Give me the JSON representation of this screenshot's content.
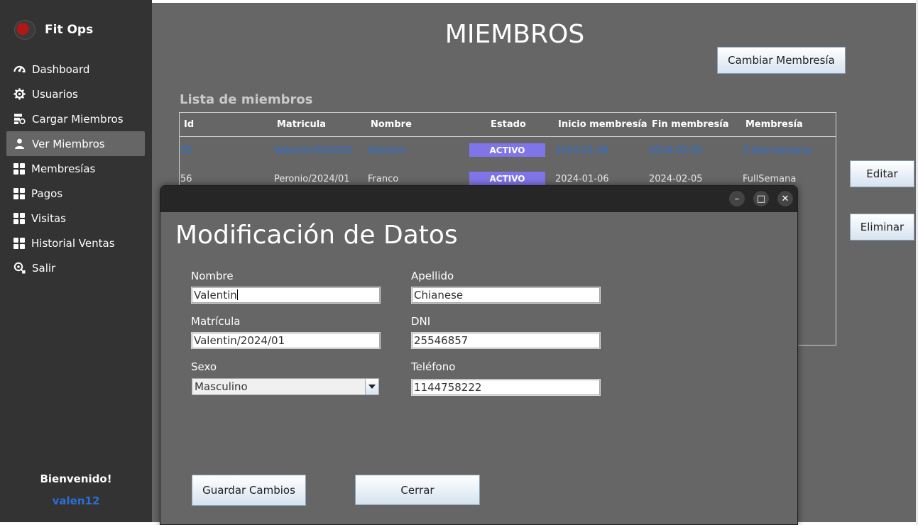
{
  "sidebar": {
    "app_name": "Fit Ops",
    "items": [
      {
        "label": "Dashboard",
        "icon": "speedometer-icon"
      },
      {
        "label": "Usuarios",
        "icon": "gear-icon"
      },
      {
        "label": "Cargar Miembros",
        "icon": "database-sync-icon"
      },
      {
        "label": "Ver Miembros",
        "icon": "user-icon",
        "active": true
      },
      {
        "label": "Membresías",
        "icon": "grid-icon"
      },
      {
        "label": "Pagos",
        "icon": "grid-icon"
      },
      {
        "label": "Visitas",
        "icon": "grid-icon"
      },
      {
        "label": "Historial Ventas",
        "icon": "grid-icon"
      },
      {
        "label": "Salir",
        "icon": "logout-icon"
      }
    ],
    "welcome": "Bienvenido!",
    "username": "valen12"
  },
  "main": {
    "title": "MIEMBROS",
    "change_membership_button": "Cambiar Membresía",
    "edit_button": "Editar",
    "delete_button": "Eliminar",
    "list_title": "Lista de miembros",
    "table": {
      "headers": [
        "Id",
        "Matricula",
        "Nombre",
        "Estado",
        "Inicio membresía",
        "Fin membresía",
        "Membresía"
      ],
      "rows": [
        [
          "55",
          "Valentin/2024/01",
          "Valentin",
          "ACTIVO",
          "2024-01-06",
          "2024-02-05",
          "3 dias*semana"
        ],
        [
          "56",
          "Peronio/2024/01",
          "Franco",
          "ACTIVO",
          "2024-01-06",
          "2024-02-05",
          "FullSemana"
        ]
      ]
    }
  },
  "dialog": {
    "window_controls": {
      "minimize": "–",
      "maximize": "□",
      "close": "✕"
    },
    "title": "Modificación de Datos",
    "fields": {
      "nombre": {
        "label": "Nombre",
        "value": "Valentin"
      },
      "apellido": {
        "label": "Apellido",
        "value": "Chianese"
      },
      "matricula": {
        "label": "Matrícula",
        "value": "Valentin/2024/01"
      },
      "dni": {
        "label": "DNI",
        "value": "25546857"
      },
      "sexo": {
        "label": "Sexo",
        "value": "Masculino"
      },
      "telefono": {
        "label": "Teléfono",
        "value": "1144758222"
      }
    },
    "save_button": "Guardar Cambios",
    "close_button": "Cerrar"
  },
  "colors": {
    "sidebar_bg": "#333333",
    "main_bg": "#666666",
    "accent_link": "#2a6fd6",
    "badge_bg": "#8075e8",
    "titlebar_bg": "#262626"
  }
}
